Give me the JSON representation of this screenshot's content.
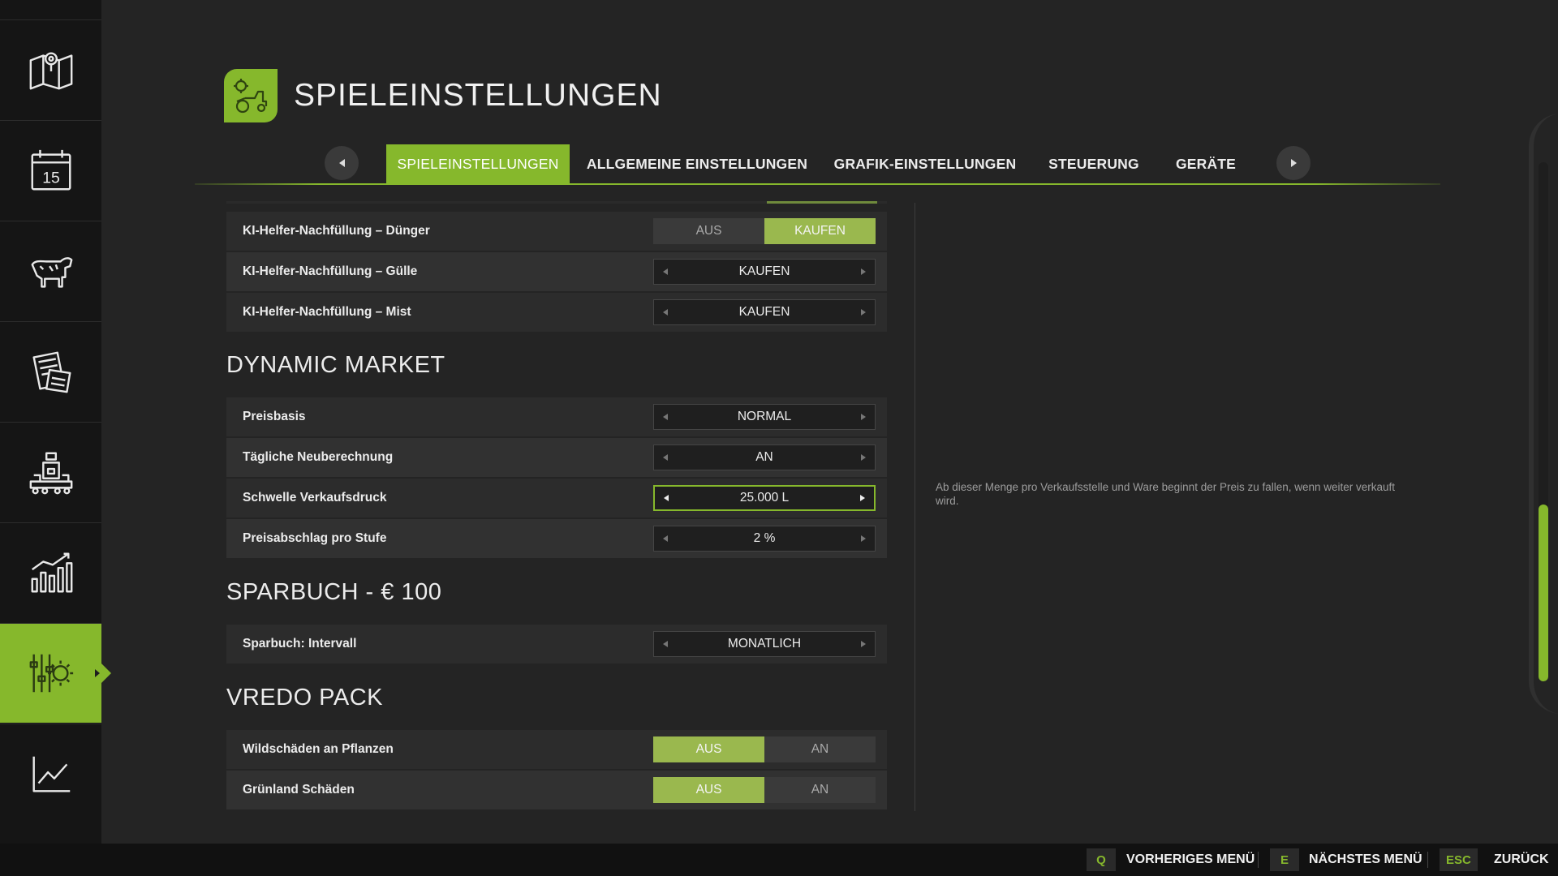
{
  "header": {
    "title": "SPIELEINSTELLUNGEN",
    "icon": "farm-gear-tractor-icon"
  },
  "tabs": [
    {
      "label": "SPIELEINSTELLUNGEN",
      "active": true
    },
    {
      "label": "ALLGEMEINE EINSTELLUNGEN",
      "active": false
    },
    {
      "label": "GRAFIK-EINSTELLUNGEN",
      "active": false
    },
    {
      "label": "STEUERUNG",
      "active": false
    },
    {
      "label": "GERÄTE",
      "active": false
    }
  ],
  "sidebar": {
    "items": [
      {
        "icon": "map-icon"
      },
      {
        "icon": "calendar-icon",
        "text": "15"
      },
      {
        "icon": "animals-icon"
      },
      {
        "icon": "contracts-icon"
      },
      {
        "icon": "production-icon"
      },
      {
        "icon": "statistics-icon"
      },
      {
        "icon": "settings-icon",
        "active": true
      },
      {
        "icon": "graph-icon"
      }
    ]
  },
  "settings": {
    "rows_top": [
      {
        "label": "KI-Helfer-Nachfüllung – Dünger",
        "type": "toggle",
        "options": [
          "AUS",
          "KAUFEN"
        ],
        "selected": 1
      },
      {
        "label": "KI-Helfer-Nachfüllung – Gülle",
        "type": "selector",
        "value": "KAUFEN"
      },
      {
        "label": "KI-Helfer-Nachfüllung – Mist",
        "type": "selector",
        "value": "KAUFEN"
      }
    ],
    "section_dynamic": "DYNAMIC MARKET",
    "rows_dynamic": [
      {
        "label": "Preisbasis",
        "type": "selector",
        "value": "NORMAL"
      },
      {
        "label": "Tägliche Neuberechnung",
        "type": "selector",
        "value": "AN"
      },
      {
        "label": "Schwelle Verkaufsdruck",
        "type": "selector",
        "value": "25.000 L",
        "focused": true
      },
      {
        "label": "Preisabschlag pro Stufe",
        "type": "selector",
        "value": "2 %"
      }
    ],
    "section_sparbuch": "SPARBUCH - € 100",
    "rows_sparbuch": [
      {
        "label": "Sparbuch: Intervall",
        "type": "selector",
        "value": "MONATLICH"
      }
    ],
    "section_vredo": "VREDO PACK",
    "rows_vredo": [
      {
        "label": "Wildschäden an Pflanzen",
        "type": "toggle",
        "options": [
          "AUS",
          "AN"
        ],
        "selected": 0
      },
      {
        "label": "Grünland Schäden",
        "type": "toggle",
        "options": [
          "AUS",
          "AN"
        ],
        "selected": 0
      }
    ]
  },
  "description": "Ab dieser Menge pro Verkaufsstelle und Ware beginnt der Preis zu fallen, wenn weiter verkauft wird.",
  "scrollbar": {
    "position_fraction": 0.66
  },
  "footer": {
    "actions": [
      {
        "key": "Q",
        "label": "VORHERIGES MENÜ"
      },
      {
        "key": "E",
        "label": "NÄCHSTES MENÜ"
      },
      {
        "key": "ESC",
        "label": "ZURÜCK"
      }
    ]
  },
  "colors": {
    "accent": "#86b82c",
    "toggle_on": "#9ab84e",
    "background": "#242424",
    "sidebar": "#151515"
  }
}
